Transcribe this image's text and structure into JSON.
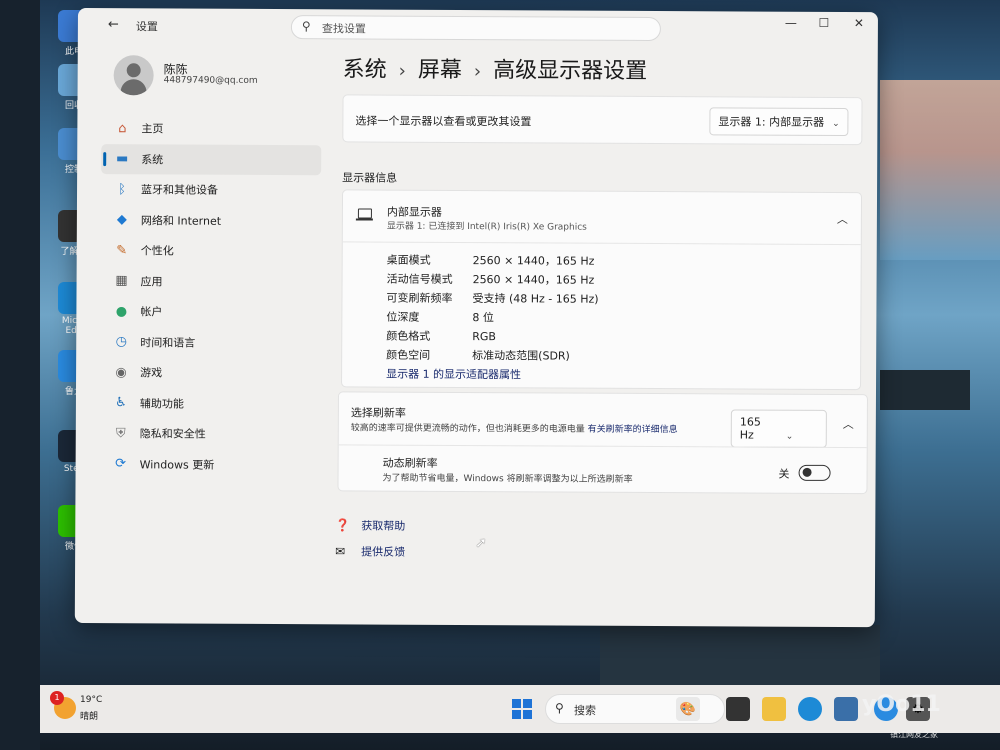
{
  "desktop": {
    "icons": [
      {
        "label": "此电",
        "icon": "computer-icon",
        "color": "#3b7bd4"
      },
      {
        "label": "回收",
        "icon": "recycle-bin-icon",
        "color": "#6aa8d8"
      },
      {
        "label": "控制",
        "icon": "control-panel-icon",
        "color": "#4b8ed1"
      },
      {
        "label": "了解此",
        "icon": "learn-icon",
        "color": "#333333"
      },
      {
        "label": "Micro Edg",
        "icon": "edge-icon",
        "color": "#1d8ad6"
      },
      {
        "label": "鲁大",
        "icon": "ludashi-icon",
        "color": "#2a8be0"
      },
      {
        "label": "Stea",
        "icon": "steam-icon",
        "color": "#1b2838"
      },
      {
        "label": "微信",
        "icon": "wechat-icon",
        "color": "#2dc100"
      }
    ]
  },
  "window": {
    "title": "设置",
    "back_glyph": "←",
    "search_placeholder": "查找设置",
    "controls": {
      "minimize": "—",
      "maximize": "☐",
      "close": "✕"
    }
  },
  "user": {
    "name": "陈陈",
    "email": "448797490@qq.com"
  },
  "sidebar": {
    "items": [
      {
        "label": "主页",
        "icon": "home-icon",
        "glyph": "⌂",
        "color": "#c75a3a"
      },
      {
        "label": "系统",
        "icon": "system-icon",
        "glyph": "▬",
        "color": "#2b79c2",
        "active": true
      },
      {
        "label": "蓝牙和其他设备",
        "icon": "bluetooth-icon",
        "glyph": "ᛒ",
        "color": "#2b79c2"
      },
      {
        "label": "网络和 Internet",
        "icon": "wifi-icon",
        "glyph": "◆",
        "color": "#1f7ad2"
      },
      {
        "label": "个性化",
        "icon": "personalization-icon",
        "glyph": "✎",
        "color": "#c46b2b"
      },
      {
        "label": "应用",
        "icon": "apps-icon",
        "glyph": "▦",
        "color": "#555555"
      },
      {
        "label": "帐户",
        "icon": "accounts-icon",
        "glyph": "●",
        "color": "#2ea36a"
      },
      {
        "label": "时间和语言",
        "icon": "time-language-icon",
        "glyph": "◷",
        "color": "#2b79c2"
      },
      {
        "label": "游戏",
        "icon": "gaming-icon",
        "glyph": "◉",
        "color": "#666666"
      },
      {
        "label": "辅助功能",
        "icon": "accessibility-icon",
        "glyph": "♿",
        "color": "#1f6fb8"
      },
      {
        "label": "隐私和安全性",
        "icon": "privacy-shield-icon",
        "glyph": "⛨",
        "color": "#777777"
      },
      {
        "label": "Windows 更新",
        "icon": "windows-update-icon",
        "glyph": "⟳",
        "color": "#1f7ad2"
      }
    ]
  },
  "breadcrumb": {
    "part1": "系统",
    "part2": "屏幕",
    "part3": "高级显示器设置",
    "separator": "›"
  },
  "display_select": {
    "label": "选择一个显示器以查看或更改其设置",
    "value": "显示器 1: 内部显示器"
  },
  "display_info": {
    "section_title": "显示器信息",
    "title": "内部显示器",
    "subtitle": "显示器 1: 已连接到 Intel(R) Iris(R) Xe Graphics",
    "specs": [
      {
        "key": "桌面模式",
        "value": "2560 × 1440，165 Hz"
      },
      {
        "key": "活动信号模式",
        "value": "2560 × 1440，165 Hz"
      },
      {
        "key": "可变刷新频率",
        "value": "受支持 (48 Hz - 165 Hz)"
      },
      {
        "key": "位深度",
        "value": "8 位"
      },
      {
        "key": "颜色格式",
        "value": "RGB"
      },
      {
        "key": "颜色空间",
        "value": "标准动态范围(SDR)"
      }
    ],
    "adapter_link": "显示器 1 的显示适配器属性"
  },
  "refresh": {
    "title": "选择刷新率",
    "description": "较高的速率可提供更流畅的动作，但也消耗更多的电源电量",
    "more_link": "有关刷新率的详细信息",
    "value": "165 Hz",
    "dynamic_title": "动态刷新率",
    "dynamic_desc": "为了帮助节省电量，Windows 将刷新率调整为以上所选刷新率",
    "toggle_label": "关"
  },
  "help": {
    "get_help": "获取帮助",
    "feedback": "提供反馈"
  },
  "taskbar": {
    "weather_temp": "19°C",
    "weather_cond": "晴朗",
    "weather_badge": "1",
    "search_label": "搜索"
  },
  "watermark": {
    "text": "yOo11",
    "sub": "镇江网友之家"
  }
}
